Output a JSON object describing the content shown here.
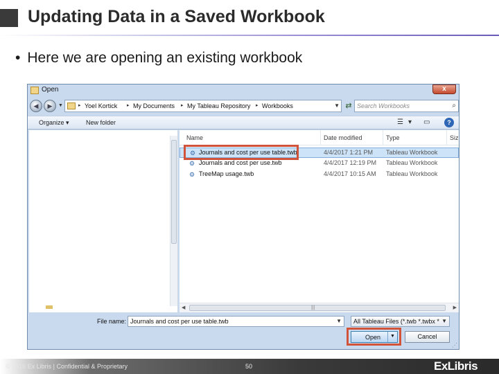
{
  "slide": {
    "title": "Updating Data in a Saved Workbook",
    "bullet": "Here we are opening an existing workbook",
    "bullet_glyph": "•"
  },
  "dialog": {
    "title": "Open",
    "close_label": "x",
    "breadcrumbs": [
      "Yoel Kortick",
      "My Documents",
      "My Tableau Repository",
      "Workbooks"
    ],
    "crumb_separator": "▸",
    "search_placeholder": "Search Workbooks",
    "toolbar": {
      "organize": "Organize ▾",
      "new_folder": "New folder"
    },
    "columns": {
      "name": "Name",
      "date": "Date modified",
      "type": "Type",
      "size": "Size"
    },
    "files": [
      {
        "name": "Journals and cost per use table.twb",
        "date": "4/4/2017 1:21 PM",
        "type": "Tableau Workbook",
        "selected": true
      },
      {
        "name": "Journals and cost per use.twb",
        "date": "4/4/2017 12:19 PM",
        "type": "Tableau Workbook",
        "selected": false
      },
      {
        "name": "TreeMap usage.twb",
        "date": "4/4/2017 10:15 AM",
        "type": "Tableau Workbook",
        "selected": false
      }
    ],
    "filename_label": "File name:",
    "filename_value": "Journals and cost per use table.twb",
    "filetype_value": "All Tableau Files (*.twb *.twbx *",
    "open_label": "Open",
    "cancel_label": "Cancel"
  },
  "footer": {
    "copyright": "© 2016 Ex Libris | Confidential & Proprietary",
    "page": "50",
    "logo": "ExLibris"
  },
  "colors": {
    "highlight": "#d0533a",
    "dialog_bg": "#c9d9ee",
    "footer": "#2a2a2a"
  }
}
